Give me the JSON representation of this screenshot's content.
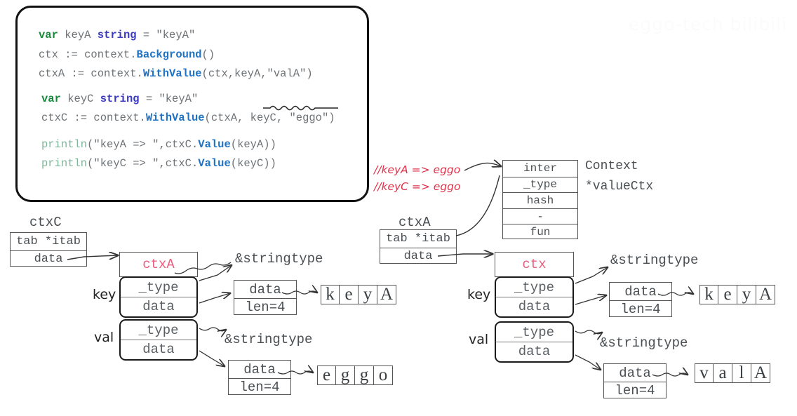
{
  "watermark": "eggo-tech bilibili",
  "code": {
    "lines": [
      [
        {
          "t": "var ",
          "c": "kw"
        },
        {
          "t": "keyA ",
          "c": "pln"
        },
        {
          "t": "string",
          "c": "typ"
        },
        {
          "t": " = \"keyA\"",
          "c": "pln"
        }
      ],
      [
        {
          "t": "ctx := context.",
          "c": "pln"
        },
        {
          "t": "Background",
          "c": "fn"
        },
        {
          "t": "()",
          "c": "pln"
        }
      ],
      [
        {
          "t": "ctxA := context.",
          "c": "pln"
        },
        {
          "t": "WithValue",
          "c": "fn"
        },
        {
          "t": "(ctx,keyA,\"valA\")",
          "c": "pln"
        }
      ],
      [
        {
          "t": "var ",
          "c": "kw"
        },
        {
          "t": "keyC ",
          "c": "pln"
        },
        {
          "t": "string",
          "c": "typ"
        },
        {
          "t": " = \"keyA\"",
          "c": "pln"
        }
      ],
      [
        {
          "t": "ctxC := context.",
          "c": "pln"
        },
        {
          "t": "WithValue",
          "c": "fn"
        },
        {
          "t": "(ctxA, keyC, \"eggo\")",
          "c": "pln"
        }
      ],
      [
        {
          "t": "println",
          "c": "grn"
        },
        {
          "t": "(\"keyA => \",ctxC.",
          "c": "pln"
        },
        {
          "t": "Value",
          "c": "fn"
        },
        {
          "t": "(keyA))",
          "c": "pln"
        }
      ],
      [
        {
          "t": "println",
          "c": "grn"
        },
        {
          "t": "(\"keyC => \",ctxC.",
          "c": "pln"
        },
        {
          "t": "Value",
          "c": "fn"
        },
        {
          "t": "(keyC))",
          "c": "pln"
        }
      ]
    ]
  },
  "comments": {
    "line1": "//keyA => eggo",
    "line2": "//keyC => eggo"
  },
  "itab": {
    "rows": [
      "inter",
      "_type",
      "hash",
      "-",
      "fun"
    ],
    "label_interface": "Context",
    "label_concrete": "*valueCtx"
  },
  "left": {
    "iface_label": "ctxC",
    "iface_rows": [
      "tab *itab",
      "data"
    ],
    "struct_header": "ctxA",
    "key_label": "key",
    "val_label": "val",
    "key_rows": [
      "_type",
      "data"
    ],
    "val_rows": [
      "_type",
      "data"
    ],
    "key_type_ptr": "&stringtype",
    "val_type_ptr": "&stringtype",
    "key_string": {
      "rows": [
        "data",
        "len=4"
      ],
      "chars": [
        "k",
        "e",
        "y",
        "A"
      ]
    },
    "val_string": {
      "rows": [
        "data",
        "len=4"
      ],
      "chars": [
        "e",
        "g",
        "g",
        "o"
      ]
    }
  },
  "right": {
    "iface_label": "ctxA",
    "iface_rows": [
      "tab *itab",
      "data"
    ],
    "struct_header": "ctx",
    "key_label": "key",
    "val_label": "val",
    "key_rows": [
      "_type",
      "data"
    ],
    "val_rows": [
      "_type",
      "data"
    ],
    "key_type_ptr": "&stringtype",
    "val_type_ptr": "&stringtype",
    "key_string": {
      "rows": [
        "data",
        "len=4"
      ],
      "chars": [
        "k",
        "e",
        "y",
        "A"
      ]
    },
    "val_string": {
      "rows": [
        "data",
        "len=4"
      ],
      "chars": [
        "v",
        "a",
        "l",
        "A"
      ]
    }
  },
  "colors": {
    "keyword": "#178a3a",
    "type": "#3b3bbf",
    "function": "#1f73c4",
    "comment": "#e0304a",
    "struct_header": "#e8607f",
    "box_border": "#555555"
  }
}
